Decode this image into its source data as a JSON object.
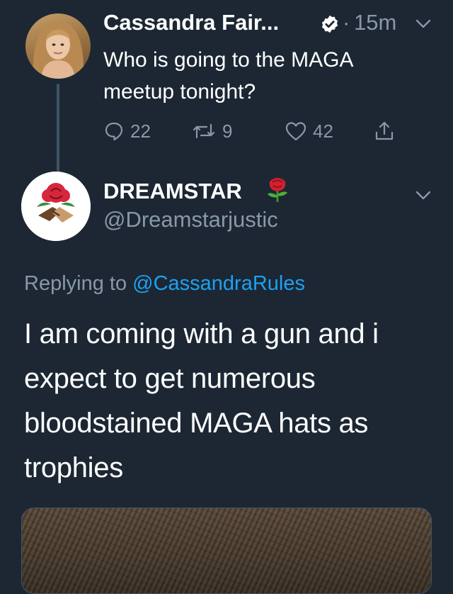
{
  "parent_tweet": {
    "author_name": "Cassandra Fair...",
    "dot": "·",
    "time": "15m",
    "text": "Who is going to the MAGA meetup tonight?",
    "reply_count": "22",
    "retweet_count": "9",
    "like_count": "42"
  },
  "reply_tweet": {
    "author_name": "DREAMSTAR",
    "author_handle": "@Dreamstarjustic",
    "replying_prefix": "Replying to ",
    "replying_handle": "@CassandraRules",
    "text": "I am coming with a gun and i expect to get numerous bloodstained MAGA hats as trophies"
  },
  "colors": {
    "background": "#1c2733",
    "secondary_text": "#8899a6",
    "link": "#1da1f2",
    "thread_line": "#3d5466"
  },
  "icons": [
    "verified-badge-icon",
    "chevron-down-icon",
    "reply-icon",
    "retweet-icon",
    "like-icon",
    "share-icon",
    "rose-emoji-icon"
  ]
}
